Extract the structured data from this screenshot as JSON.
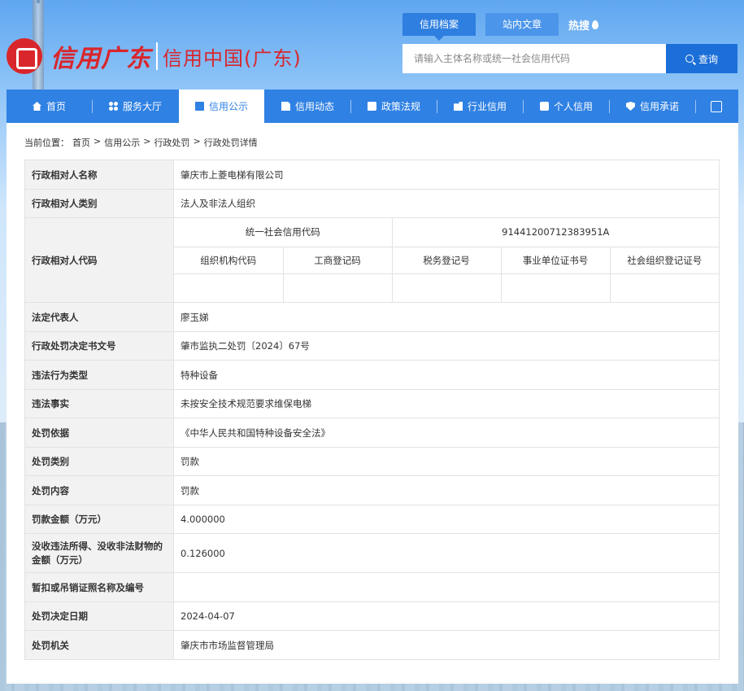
{
  "header": {
    "logo_script": "信用广东",
    "logo_title": "信用中国(广东)",
    "top_tabs": [
      {
        "label": "信用档案",
        "active": true
      },
      {
        "label": "站内文章",
        "active": false
      }
    ],
    "hot_search": "热搜",
    "search": {
      "placeholder": "请输入主体名称或统一社会信用代码",
      "button": "查询"
    }
  },
  "nav": {
    "items": [
      {
        "label": "首页",
        "icon": "home-icon",
        "active": false
      },
      {
        "label": "服务大厅",
        "icon": "grid-icon",
        "active": false
      },
      {
        "label": "信用公示",
        "icon": "briefcase-icon",
        "active": true
      },
      {
        "label": "信用动态",
        "icon": "document-icon",
        "active": false
      },
      {
        "label": "政策法规",
        "icon": "book-icon",
        "active": false
      },
      {
        "label": "行业信用",
        "icon": "building-icon",
        "active": false
      },
      {
        "label": "个人信用",
        "icon": "user-icon",
        "active": false
      },
      {
        "label": "信用承诺",
        "icon": "shield-icon",
        "active": false
      }
    ]
  },
  "breadcrumb": {
    "prefix": "当前位置：",
    "items": [
      "首页",
      "信用公示",
      "行政处罚",
      "行政处罚详情"
    ],
    "separator": ">"
  },
  "detail": {
    "name_label": "行政相对人名称",
    "name_value": "肇庆市上菱电梯有限公司",
    "type_label": "行政相对人类别",
    "type_value": "法人及非法人组织",
    "code_label": "行政相对人代码",
    "uscc_label": "统一社会信用代码",
    "uscc_value": "91441200712383951A",
    "code_headers": [
      "组织机构代码",
      "工商登记码",
      "税务登记号",
      "事业单位证书号",
      "社会组织登记证号"
    ],
    "code_values": [
      "",
      "",
      "",
      "",
      ""
    ],
    "rows": [
      {
        "label": "法定代表人",
        "value": "廖玉娣"
      },
      {
        "label": "行政处罚决定书文号",
        "value": "肇市监执二处罚〔2024〕67号"
      },
      {
        "label": "违法行为类型",
        "value": "特种设备"
      },
      {
        "label": "违法事实",
        "value": "未按安全技术规范要求维保电梯"
      },
      {
        "label": "处罚依据",
        "value": "《中华人民共和国特种设备安全法》"
      },
      {
        "label": "处罚类别",
        "value": "罚款"
      },
      {
        "label": "处罚内容",
        "value": "罚款"
      },
      {
        "label": "罚款金额（万元）",
        "value": "4.000000"
      },
      {
        "label": "没收违法所得、没收非法财物的金额（万元）",
        "value": "0.126000"
      },
      {
        "label": "暂扣或吊销证照名称及编号",
        "value": ""
      },
      {
        "label": "处罚决定日期",
        "value": "2024-04-07"
      },
      {
        "label": "处罚机关",
        "value": "肇庆市市场监督管理局"
      }
    ]
  },
  "colors": {
    "brand_red": "#d9262c",
    "nav_blue": "#2f81e3",
    "search_button": "#1c6fd8",
    "label_bg": "#f2f2f2"
  }
}
